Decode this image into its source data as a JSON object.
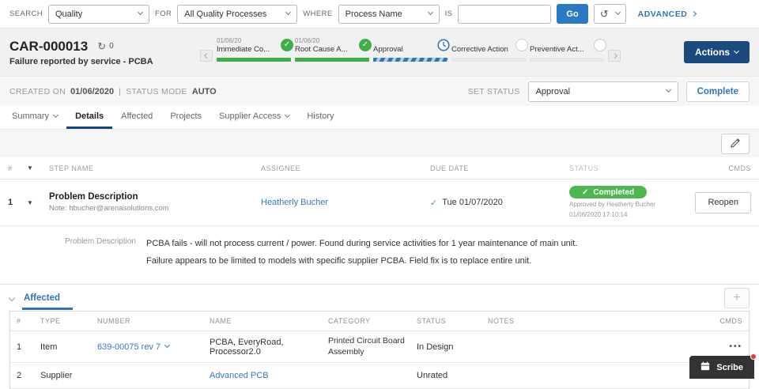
{
  "search": {
    "search_label": "SEARCH",
    "search_value": "Quality",
    "for_label": "FOR",
    "for_value": "All Quality Processes",
    "where_label": "WHERE",
    "where_value": "Process Name",
    "is_label": "IS",
    "is_value": "",
    "go_label": "Go",
    "history_icon": "↺",
    "advanced_label": "ADVANCED"
  },
  "header": {
    "record_id": "CAR-000013",
    "refresh_icon": "↻",
    "refresh_count": "0",
    "subtitle": "Failure reported by service - PCBA",
    "actions_label": "Actions",
    "steps": [
      {
        "date": "01/06/20",
        "name": "Immediate Co...",
        "status": "complete"
      },
      {
        "date": "01/06/20",
        "name": "Root Cause A...",
        "status": "complete"
      },
      {
        "date": "",
        "name": "Approval",
        "status": "in-progress"
      },
      {
        "date": "",
        "name": "Corrective Action",
        "status": "pending"
      },
      {
        "date": "",
        "name": "Preventive Act...",
        "status": "pending"
      }
    ]
  },
  "status_row": {
    "created_label": "CREATED ON",
    "created_value": "01/06/2020",
    "separator": "|",
    "mode_label": "STATUS MODE",
    "mode_value": "AUTO",
    "set_status_label": "SET STATUS",
    "set_status_value": "Approval",
    "complete_label": "Complete"
  },
  "tabs": [
    {
      "label": "Summary"
    },
    {
      "label": "Details"
    },
    {
      "label": "Affected"
    },
    {
      "label": "Projects"
    },
    {
      "label": "Supplier Access"
    },
    {
      "label": "History"
    }
  ],
  "steps_table": {
    "headers": {
      "num": "#",
      "caret": "▼",
      "step_name": "STEP NAME",
      "assignee": "ASSIGNEE",
      "due_date": "DUE DATE",
      "status": "STATUS",
      "cmds": "CMDS"
    },
    "row": {
      "num": "1",
      "caret": "▼",
      "name": "Problem Description",
      "note": "Note: hbucher@arenasolutions.com",
      "assignee": "Heatherly Bucher",
      "due_check": "✓",
      "due_date": "Tue 01/07/2020",
      "badge_check": "✓",
      "badge_label": "Completed",
      "approved_by": "Approved by Heatherly Bucher",
      "approved_at": "01/06/2020 17:10:14",
      "reopen_label": "Reopen"
    },
    "detail": {
      "label": "Problem Description",
      "text": "PCBA fails - will not process current / power. Found during service activities for 1 year maintenance of main unit. Failure appears to be limited to models with specific supplier PCBA. Field fix is to replace entire unit."
    }
  },
  "affected": {
    "title": "Affected",
    "headers": {
      "num": "#",
      "type": "TYPE",
      "number": "NUMBER",
      "name": "NAME",
      "category": "CATEGORY",
      "status": "STATUS",
      "notes": "NOTES",
      "cmds": "CMDS"
    },
    "rows": [
      {
        "num": "1",
        "type": "Item",
        "number": "639-00075 rev 7",
        "name": "PCBA, EveryRoad, Processor2.0",
        "category": "Printed Circuit Board Assembly",
        "status": "In Design",
        "notes": "",
        "cmds": "•••"
      },
      {
        "num": "2",
        "type": "Supplier",
        "number": "",
        "name": "Advanced PCB",
        "category": "",
        "status": "Unrated",
        "notes": "",
        "cmds": ""
      }
    ]
  },
  "scribe": {
    "label": "Scribe"
  }
}
